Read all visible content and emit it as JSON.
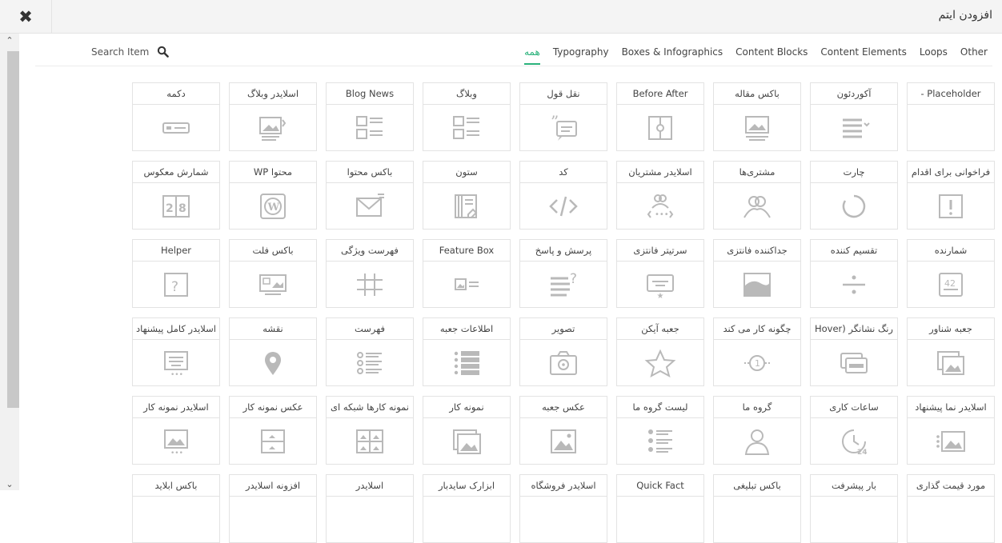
{
  "dialog": {
    "close_glyph": "✖",
    "title": "افزودن ایتم"
  },
  "scrollbar": {
    "up_glyph": "⌃",
    "down_glyph": "⌄"
  },
  "search": {
    "label": "Search Item",
    "icon": "search-icon"
  },
  "tabs": [
    {
      "label": "همه",
      "active": true
    },
    {
      "label": "Typography"
    },
    {
      "label": "Boxes & Infographics"
    },
    {
      "label": "Content Blocks"
    },
    {
      "label": "Content Elements"
    },
    {
      "label": "Loops"
    },
    {
      "label": "Other"
    }
  ],
  "accent_color": "#2ab27b",
  "items": [
    {
      "label": "دکمه",
      "icon": "button"
    },
    {
      "label": "اسلایدر وبلاگ",
      "icon": "blog-slider"
    },
    {
      "label": "Blog News",
      "icon": "list"
    },
    {
      "label": "وبلاگ",
      "icon": "list"
    },
    {
      "label": "نقل قول",
      "icon": "quote"
    },
    {
      "label": "Before After",
      "icon": "before-after"
    },
    {
      "label": "باکس مقاله",
      "icon": "article-box"
    },
    {
      "label": "آکوردئون",
      "icon": "accordion"
    },
    {
      "label": "Placeholder -",
      "icon": "none"
    },
    {
      "label": "شمارش معکوس",
      "icon": "countdown"
    },
    {
      "label": "محتوا WP",
      "icon": "wordpress"
    },
    {
      "label": "باکس محتوا",
      "icon": "mail"
    },
    {
      "label": "ستون",
      "icon": "column"
    },
    {
      "label": "کد",
      "icon": "code"
    },
    {
      "label": "اسلایدر مشتریان",
      "icon": "clients-slider"
    },
    {
      "label": "مشتری‌ها",
      "icon": "users"
    },
    {
      "label": "چارت",
      "icon": "chart"
    },
    {
      "label": "فراخوانی برای اقدام",
      "icon": "cta"
    },
    {
      "label": "Helper",
      "icon": "help"
    },
    {
      "label": "باکس فلت",
      "icon": "flat-box"
    },
    {
      "label": "فهرست ویژگی",
      "icon": "hash"
    },
    {
      "label": "Feature Box",
      "icon": "feature-box"
    },
    {
      "label": "پرسش و پاسخ",
      "icon": "faq"
    },
    {
      "label": "سرتیتر فانتزی",
      "icon": "fancy-heading"
    },
    {
      "label": "جداکننده فانتزی",
      "icon": "fancy-divider"
    },
    {
      "label": "تقسیم کننده",
      "icon": "divider"
    },
    {
      "label": "شمارنده",
      "icon": "counter"
    },
    {
      "label": "اسلایدر کامل پیشنهاد",
      "icon": "slider-full"
    },
    {
      "label": "نقشه",
      "icon": "map"
    },
    {
      "label": "فهرست",
      "icon": "list-bullets"
    },
    {
      "label": "اطلاعات جعبه",
      "icon": "info-box"
    },
    {
      "label": "تصویر",
      "icon": "camera"
    },
    {
      "label": "جعبه آیکن",
      "icon": "star"
    },
    {
      "label": "چگونه کار می کند",
      "icon": "how-it-works"
    },
    {
      "label": "رنگ نشانگر (Hover",
      "icon": "hover-color"
    },
    {
      "label": "جعبه شناور",
      "icon": "hover-box"
    },
    {
      "label": "اسلایدر نمونه کار",
      "icon": "portfolio-slider"
    },
    {
      "label": "عکس نمونه کار",
      "icon": "portfolio-photo"
    },
    {
      "label": "نمونه کارها شبکه ای",
      "icon": "portfolio-grid"
    },
    {
      "label": "نمونه کار",
      "icon": "portfolio"
    },
    {
      "label": "عکس جعبه",
      "icon": "photo-box"
    },
    {
      "label": "لیست گروه ما",
      "icon": "team-list"
    },
    {
      "label": "گروه ما",
      "icon": "person"
    },
    {
      "label": "ساعات کاری",
      "icon": "clock"
    },
    {
      "label": "اسلایدر نما پیشنهاد",
      "icon": "offer-slider"
    },
    {
      "label": "باکس ابلاید",
      "icon": "none"
    },
    {
      "label": "افزونه اسلایدر",
      "icon": "none"
    },
    {
      "label": "اسلایدر",
      "icon": "none"
    },
    {
      "label": "ابزارک سایدبار",
      "icon": "none"
    },
    {
      "label": "اسلایدر فروشگاه",
      "icon": "none"
    },
    {
      "label": "Quick Fact",
      "icon": "none"
    },
    {
      "label": "باکس تبلیغی",
      "icon": "none"
    },
    {
      "label": "بار پیشرفت",
      "icon": "none"
    },
    {
      "label": "مورد قیمت گذاری",
      "icon": "none"
    }
  ]
}
